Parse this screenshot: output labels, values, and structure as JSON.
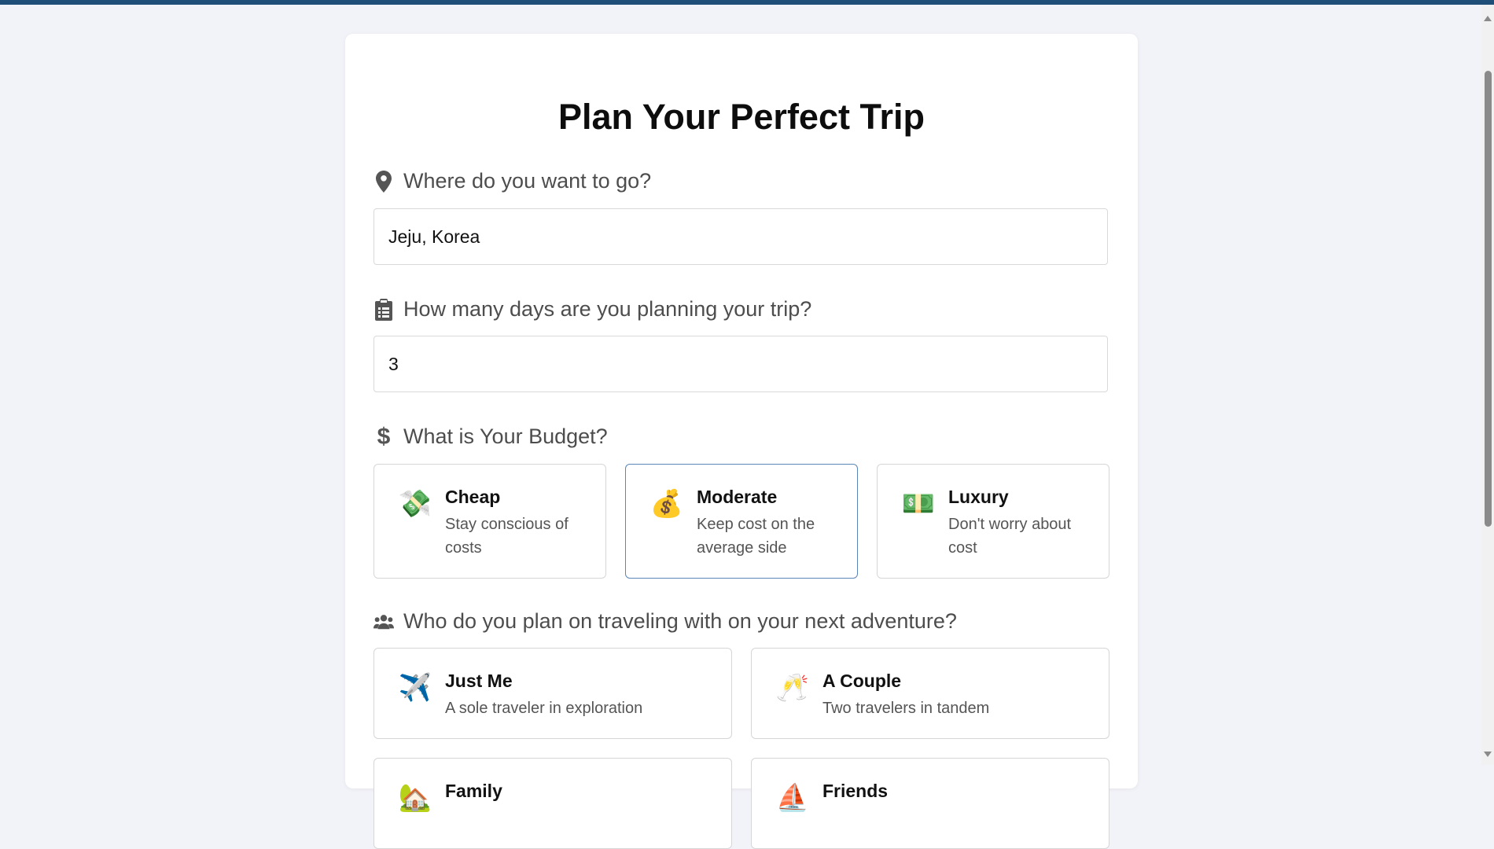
{
  "page": {
    "title": "Plan Your Perfect Trip"
  },
  "destination": {
    "question": "Where do you want to go?",
    "icon": "map-pin-icon",
    "value": "Jeju, Korea"
  },
  "days": {
    "question": "How many days are you planning your trip?",
    "icon": "clipboard-icon",
    "value": "3"
  },
  "budget": {
    "question": "What is Your Budget?",
    "icon": "dollar-icon",
    "selected": "Moderate",
    "options": [
      {
        "title": "Cheap",
        "desc_line1": "Stay conscious of",
        "desc_line2": "costs",
        "icon": "money-with-wings-emoji"
      },
      {
        "title": "Moderate",
        "desc_line1": "Keep cost on the",
        "desc_line2": "average side",
        "icon": "money-bag-emoji"
      },
      {
        "title": "Luxury",
        "desc_line1": "Don't worry about",
        "desc_line2": "cost",
        "icon": "dollar-banknote-emoji"
      }
    ]
  },
  "travelers": {
    "question": "Who do you plan on traveling with on your next adventure?",
    "icon": "users-icon",
    "options": [
      {
        "title": "Just Me",
        "desc": "A sole traveler in exploration",
        "icon": "airplane-emoji"
      },
      {
        "title": "A Couple",
        "desc": "Two travelers in tandem",
        "icon": "clinking-glasses-emoji"
      },
      {
        "title": "Family",
        "desc": "",
        "icon": "house-emoji"
      },
      {
        "title": "Friends",
        "desc": "",
        "icon": "sailboat-emoji"
      }
    ]
  },
  "colors": {
    "accent_border": "#5a86b8",
    "top_strip": "#1f4e79",
    "background": "#f2f3f8"
  }
}
